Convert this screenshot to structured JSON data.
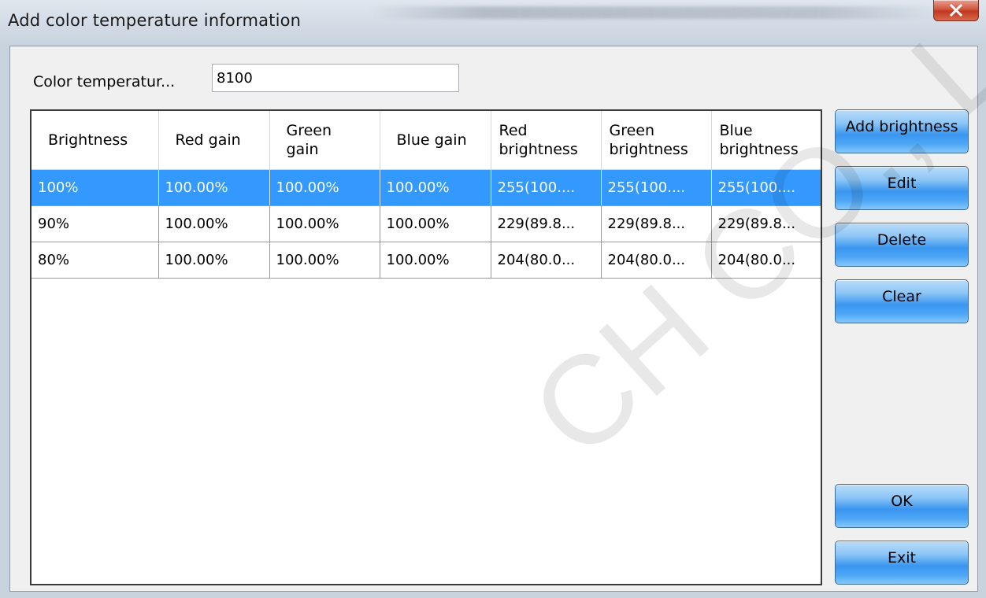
{
  "window": {
    "title": "Add color temperature information",
    "close_icon": "close-icon"
  },
  "form": {
    "color_temperature_label": "Color temperatur...",
    "color_temperature_value": "8100"
  },
  "table": {
    "columns": [
      "Brightness",
      "Red gain",
      "Green gain",
      "Blue gain",
      "Red brightness",
      "Green brightness",
      "Blue brightness"
    ],
    "rows": [
      [
        "100%",
        "100.00%",
        "100.00%",
        "100.00%",
        "255(100....",
        "255(100....",
        "255(100...."
      ],
      [
        "90%",
        "100.00%",
        "100.00%",
        "100.00%",
        "229(89.8...",
        "229(89.8...",
        "229(89.8..."
      ],
      [
        "80%",
        "100.00%",
        "100.00%",
        "100.00%",
        "204(80.0...",
        "204(80.0...",
        "204(80.0..."
      ]
    ],
    "selected_row": 0
  },
  "buttons": {
    "add_brightness": "Add brightness",
    "edit": "Edit",
    "delete": "Delete",
    "clear": "Clear",
    "ok": "OK",
    "exit": "Exit"
  },
  "watermark": "CH CO., L",
  "colors": {
    "selection": "#3399ff",
    "button": "#3a95ef"
  }
}
